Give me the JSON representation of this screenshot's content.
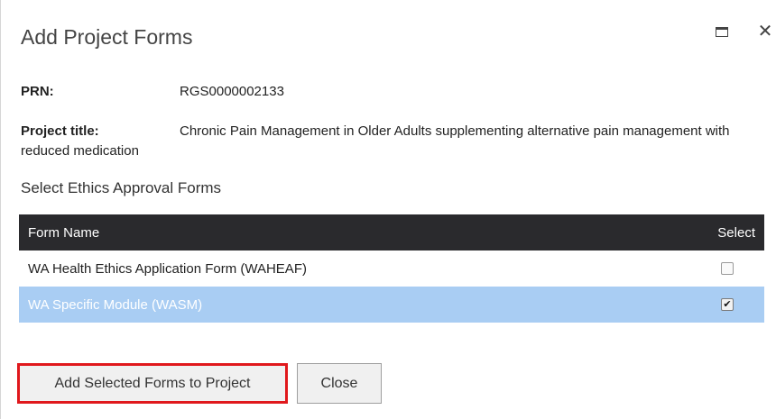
{
  "dialog": {
    "title": "Add Project Forms",
    "window_controls": {
      "maximize_icon": "maximize-icon",
      "close_icon": "close-icon",
      "close_glyph": "✕"
    }
  },
  "fields": {
    "prn_label": "PRN:",
    "prn_value": "RGS0000002133",
    "project_title_label": "Project title:",
    "project_title_value": "Chronic Pain Management in Older Adults supplementing alternative pain management with reduced medication"
  },
  "section_label": "Select Ethics Approval Forms",
  "table": {
    "headers": {
      "form_name": "Form Name",
      "select": "Select"
    },
    "rows": [
      {
        "name": "WA Health Ethics Application Form (WAHEAF)",
        "checked": false
      },
      {
        "name": "WA Specific Module (WASM)",
        "checked": true
      }
    ]
  },
  "buttons": {
    "add_label": "Add Selected Forms to Project",
    "close_label": "Close"
  },
  "colors": {
    "header_bg": "#2a2a2d",
    "selected_row_bg": "#a9cdf3",
    "highlight_border": "#e0181c"
  }
}
